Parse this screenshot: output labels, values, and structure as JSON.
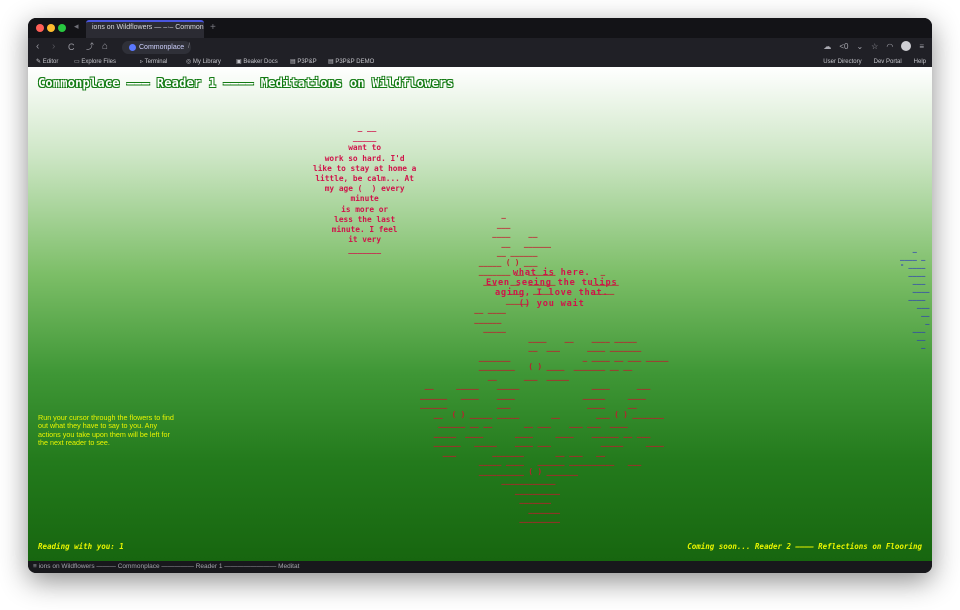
{
  "browser": {
    "tab_title": "ions on Wildflowers — –·– Commonp...",
    "new_tab": "+",
    "url_label": "Commonplace",
    "url_path": "/",
    "nav_icons": {
      "back": "‹",
      "forward": "›",
      "reload": "C",
      "up": "⤴",
      "home": "⌂"
    },
    "right_icons": [
      "cloud-icon",
      "share-icon",
      "chevron-down-icon",
      "star-icon",
      "wifi-icon",
      "avatar",
      "menu-icon"
    ],
    "share_count": "0"
  },
  "bookmarks": {
    "left": [
      "Editor",
      "Explore Files",
      "Terminal",
      "My Library",
      "Beaker Docs",
      "P3P&P",
      "P3P&P DEMO"
    ],
    "right": [
      "User Directory",
      "Dev Portal",
      "Help"
    ]
  },
  "page": {
    "title": "Commonplace ——— Reader 1 ———— Meditations on Wildflowers",
    "poem_top": " _ __\n_____\nwant to\nwork so hard. I'd\nlike to stay at home a\nlittle, be calm... At\nmy age (  ) every\nminute\nis more or\nless the last\nminute. I feel\nit very\n_______",
    "poem_middle": "what is here.\nEven seeing the tulips\naging, I love that.\n() you wait",
    "flowers": "                      _\n                     ___\n                    ____    __\n                      __   ______\n                     __ ______\n                 _____ ( ) ___\n                 _______ __ ______          _\n                  ___   __  ______        ______\n                        ___  ____         _____\n                       _____\n                __ ____\n                ______\n                  _____\n                            ____    __    ____ _____\n                            __  ___      ____ _______\n                 _______                _ ____ __ ___ _____\n                 ________   ( ) ____  _______ __ __\n                   __      ___  _____\n     __     _____    _____                ____      ___\n    ______   ____    ____               _____     ____\n    ______           ___                 ____     __\n       __  ( ) _____ _____       __        ___ ( ) _______\n        ______ __ __       __ ___    ___ ___  ____\n       _____  ____       ____     ____    ______ __ ___\n       ______   _____    ____ ___           _____     ____\n         ___        _______       __ ___   __\n                 _____ ____   ______ __________   ___\n                 __________ ( ) _______\n                      ____________\n                         __________\n                          _______\n                            _______\n                          _________",
    "edge_art": "   _\n____ _\n- ____\n  ____\n   ___\n   ____\n  ____\n    ___\n     __\n      _\n   ___\n    __\n     _",
    "instructions": "Run your cursor through the flowers to find out what they have to say to you. Any actions you take upon them will be left for the next reader to see.",
    "footer_left": "Reading with you: 1",
    "footer_right": "Coming soon... Reader 2 ———— Reflections on Flooring"
  },
  "statusbar": {
    "text": "≡ ions on Wildflowers ——— Commonplace ————— Reader 1 ———————— Meditat"
  },
  "colors": {
    "poem": "#d0134a",
    "flowers": "#c2192f",
    "instructions": "#e9f500",
    "gradient_top": "#ffffff",
    "gradient_bottom": "#17660f"
  }
}
